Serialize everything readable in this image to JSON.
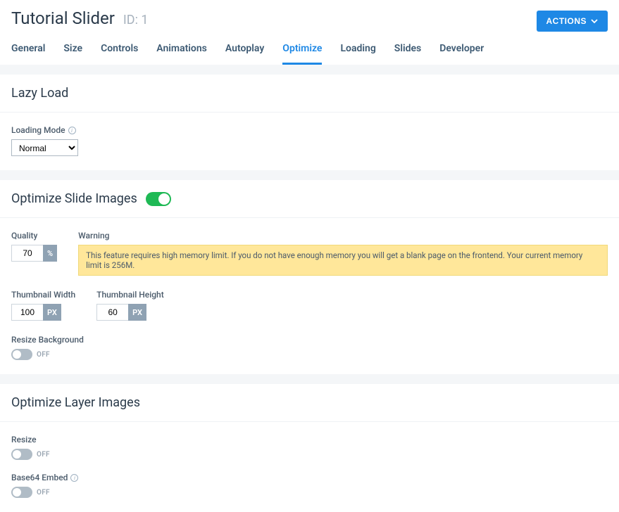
{
  "header": {
    "title": "Tutorial Slider",
    "id_label": "ID: 1",
    "actions_label": "ACTIONS"
  },
  "tabs": [
    {
      "label": "General"
    },
    {
      "label": "Size"
    },
    {
      "label": "Controls"
    },
    {
      "label": "Animations"
    },
    {
      "label": "Autoplay"
    },
    {
      "label": "Optimize",
      "active": true
    },
    {
      "label": "Loading"
    },
    {
      "label": "Slides"
    },
    {
      "label": "Developer"
    }
  ],
  "lazy_load": {
    "title": "Lazy Load",
    "loading_mode_label": "Loading Mode",
    "loading_mode_value": "Normal"
  },
  "optimize_slide": {
    "title": "Optimize Slide Images",
    "quality_label": "Quality",
    "quality_value": "70",
    "quality_unit": "%",
    "warning_label": "Warning",
    "warning_text": "This feature requires high memory limit. If you do not have enough memory you will get a blank page on the frontend. Your current memory limit is 256M.",
    "thumb_width_label": "Thumbnail Width",
    "thumb_width_value": "100",
    "thumb_height_label": "Thumbnail Height",
    "thumb_height_value": "60",
    "px_unit": "PX",
    "resize_bg_label": "Resize Background",
    "off_label": "OFF"
  },
  "optimize_layer": {
    "title": "Optimize Layer Images",
    "resize_label": "Resize",
    "base64_label": "Base64 Embed",
    "off_label": "OFF"
  }
}
